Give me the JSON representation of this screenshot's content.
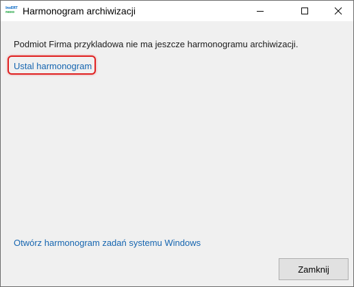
{
  "window": {
    "title": "Harmonogram archiwizacji",
    "app_icon": {
      "name": "insert-nexo-logo",
      "line1": "InsERT",
      "line2": "nexo"
    },
    "controls": {
      "minimize_icon": "minimize-icon",
      "maximize_icon": "maximize-icon",
      "close_icon": "close-icon"
    }
  },
  "content": {
    "info_text": "Podmiot Firma przykladowa nie ma jeszcze harmonogramu archiwizacji.",
    "set_schedule_link": "Ustal harmonogram",
    "windows_scheduler_link": "Otwórz harmonogram zadań systemu Windows",
    "highlight_color": "#e02020",
    "link_color": "#1565b0"
  },
  "footer": {
    "close_button": "Zamknij"
  }
}
